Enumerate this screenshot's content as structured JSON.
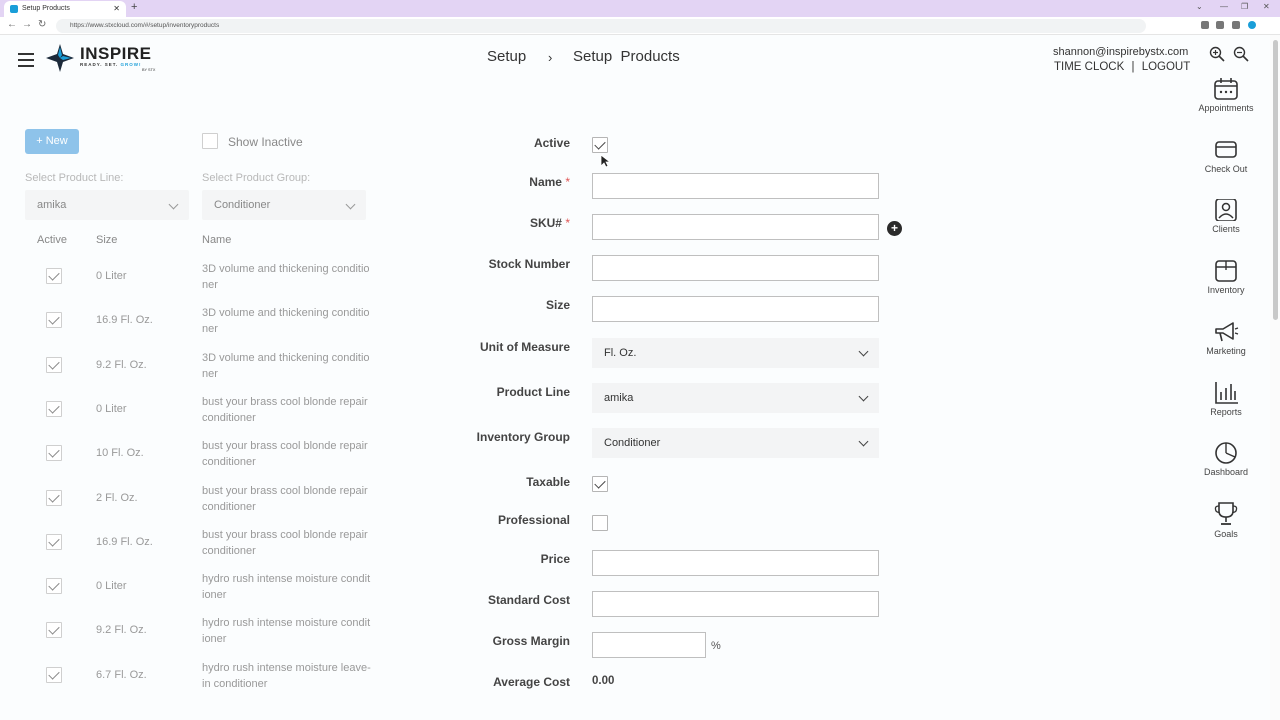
{
  "browser": {
    "tab_title": "Setup Products",
    "url": "https://www.stxcloud.com/#/setup/inventoryproducts"
  },
  "header": {
    "logo_text": "INSPIRE",
    "logo_tagline_a": "READY. SET. ",
    "logo_tagline_b": "GROW!",
    "logo_by": "BY STX",
    "breadcrumb_root": "Setup",
    "breadcrumb_sep": "›",
    "breadcrumb_current": "Setup  Products",
    "user_email": "shannon@inspirebystx.com",
    "time_clock": "TIME CLOCK",
    "link_sep": "|",
    "logout": "LOGOUT"
  },
  "right_nav": [
    {
      "label": "Appointments",
      "icon": "calendar-icon"
    },
    {
      "label": "Check Out",
      "icon": "credit-card-icon"
    },
    {
      "label": "Clients",
      "icon": "person-icon"
    },
    {
      "label": "Inventory",
      "icon": "box-icon"
    },
    {
      "label": "Marketing",
      "icon": "megaphone-icon"
    },
    {
      "label": "Reports",
      "icon": "bar-chart-icon"
    },
    {
      "label": "Dashboard",
      "icon": "pie-chart-icon"
    },
    {
      "label": "Goals",
      "icon": "trophy-icon"
    }
  ],
  "list_panel": {
    "new_button": "+ New",
    "show_inactive_label": "Show Inactive",
    "product_line_caption": "Select Product Line:",
    "product_line_value": "amika",
    "product_group_caption": "Select Product Group:",
    "product_group_value": "Conditioner",
    "columns": [
      "Active",
      "Size",
      "Name"
    ],
    "rows": [
      {
        "active": true,
        "size": "0 Liter",
        "name": "3D volume and thickening conditioner"
      },
      {
        "active": true,
        "size": "16.9 Fl. Oz.",
        "name": "3D volume and thickening conditioner"
      },
      {
        "active": true,
        "size": "9.2 Fl. Oz.",
        "name": "3D volume and thickening conditioner"
      },
      {
        "active": true,
        "size": "0 Liter",
        "name": "bust your brass cool blonde repair conditioner"
      },
      {
        "active": true,
        "size": "10 Fl. Oz.",
        "name": "bust your brass cool blonde repair conditioner"
      },
      {
        "active": true,
        "size": "2 Fl. Oz.",
        "name": "bust your brass cool blonde repair conditioner"
      },
      {
        "active": true,
        "size": "16.9 Fl. Oz.",
        "name": "bust your brass cool blonde repair conditioner"
      },
      {
        "active": true,
        "size": "0 Liter",
        "name": "hydro rush intense moisture conditioner"
      },
      {
        "active": true,
        "size": "9.2 Fl. Oz.",
        "name": "hydro rush intense moisture conditioner"
      },
      {
        "active": true,
        "size": "6.7 Fl. Oz.",
        "name": "hydro rush intense moisture leave-in conditioner"
      }
    ]
  },
  "form": {
    "active_label": "Active",
    "active_checked": true,
    "name_label": "Name",
    "required_mark": "*",
    "name_value": "",
    "sku_label": "SKU#",
    "sku_value": "",
    "sku_add_icon": "plus-circle-icon",
    "stock_label": "Stock Number",
    "stock_value": "",
    "size_label": "Size",
    "size_value": "",
    "uom_label": "Unit of Measure",
    "uom_value": "Fl. Oz.",
    "product_line_label": "Product Line",
    "product_line_value": "amika",
    "inventory_group_label": "Inventory Group",
    "inventory_group_value": "Conditioner",
    "taxable_label": "Taxable",
    "taxable_checked": true,
    "professional_label": "Professional",
    "professional_checked": false,
    "price_label": "Price",
    "price_value": "",
    "standard_cost_label": "Standard Cost",
    "standard_cost_value": "",
    "gross_margin_label": "Gross Margin",
    "gross_margin_value": "",
    "percent_sign": "%",
    "average_cost_label": "Average Cost",
    "average_cost_value": "0.00"
  }
}
